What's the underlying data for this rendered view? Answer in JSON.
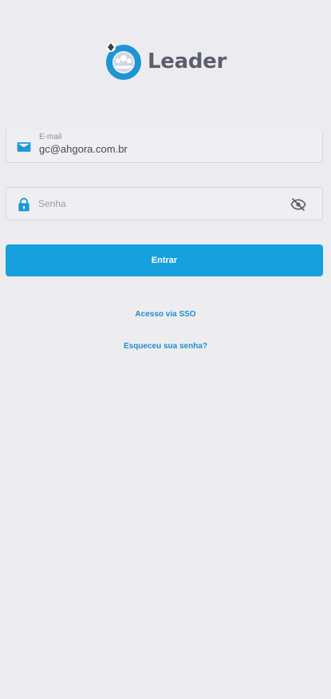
{
  "app": {
    "logo_text": "Leader",
    "accent_color": "#16a0dd"
  },
  "login": {
    "email_label": "E-mail",
    "email_value": "gc@ahgora.com.br",
    "password_placeholder": "Senha",
    "submit_label": "Entrar",
    "sso_link": "Acesso via SSO",
    "forgot_link": "Esqueceu sua senha?"
  },
  "icons": {
    "email": "envelope-icon",
    "password": "lock-icon",
    "visibility": "eye-off-icon"
  }
}
